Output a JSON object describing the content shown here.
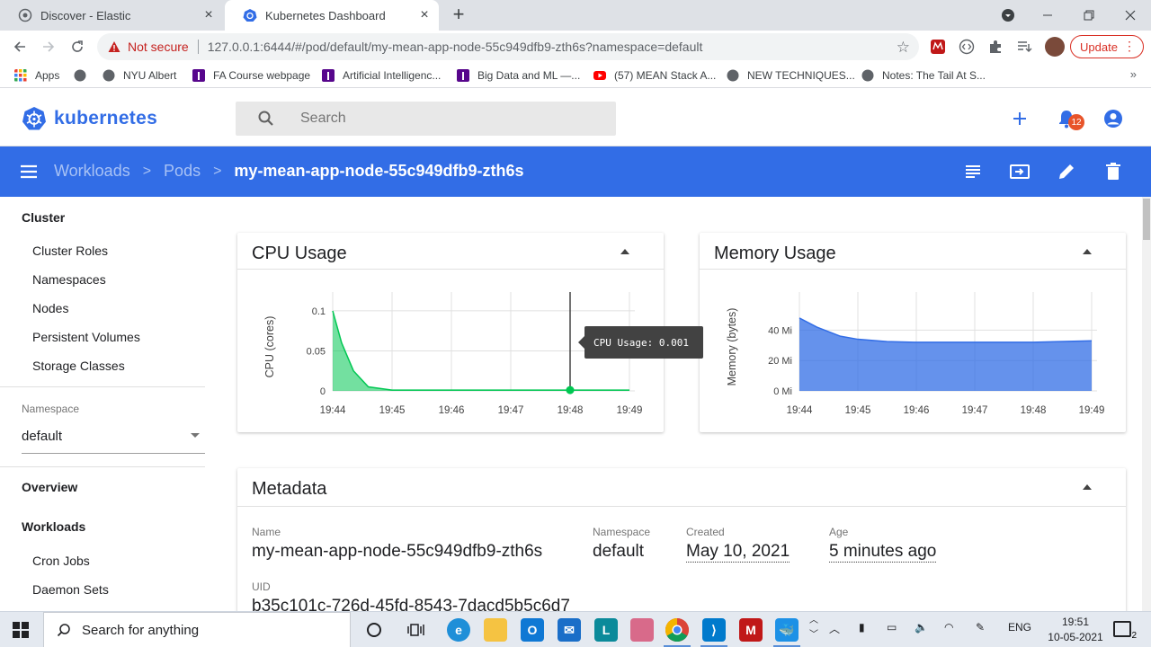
{
  "browser": {
    "tabs": [
      {
        "title": "Discover - Elastic",
        "active": false
      },
      {
        "title": "Kubernetes Dashboard",
        "active": true
      }
    ],
    "not_secure_label": "Not secure",
    "url": "127.0.0.1:6444/#/pod/default/my-mean-app-node-55c949dfb9-zth6s?namespace=default",
    "update_label": "Update",
    "bookmarks": [
      {
        "label": "Apps",
        "color": "#e8542a"
      },
      {
        "label": "",
        "color": "#5f6368"
      },
      {
        "label": "NYU Albert",
        "color": "#5f6368"
      },
      {
        "label": "FA Course webpage",
        "color": "#57068c"
      },
      {
        "label": "Artificial Intelligenc...",
        "color": "#57068c"
      },
      {
        "label": "Big Data and ML —...",
        "color": "#57068c"
      },
      {
        "label": "(57) MEAN Stack A...",
        "color": "#ff0000"
      },
      {
        "label": "NEW TECHNIQUES...",
        "color": "#5f6368"
      },
      {
        "label": "Notes: The Tail At S...",
        "color": "#5f6368"
      }
    ]
  },
  "header": {
    "brand": "kubernetes",
    "search_placeholder": "Search",
    "notification_count": "12",
    "accent": "#326de6"
  },
  "toolbar": {
    "breadcrumbs": [
      "Workloads",
      "Pods"
    ],
    "current": "my-mean-app-node-55c949dfb9-zth6s"
  },
  "sidebar": {
    "cluster_heading": "Cluster",
    "cluster_items": [
      "Cluster Roles",
      "Namespaces",
      "Nodes",
      "Persistent Volumes",
      "Storage Classes"
    ],
    "namespace_label": "Namespace",
    "namespace_value": "default",
    "overview": "Overview",
    "workloads_heading": "Workloads",
    "workload_items": [
      "Cron Jobs",
      "Daemon Sets"
    ]
  },
  "cpu_card": {
    "title": "CPU Usage",
    "tooltip": "CPU Usage: 0.001"
  },
  "memory_card": {
    "title": "Memory Usage"
  },
  "chart_data": [
    {
      "type": "area",
      "title": "CPU Usage",
      "ylabel": "CPU (cores)",
      "x": [
        "19:44",
        "19:45",
        "19:46",
        "19:47",
        "19:48",
        "19:49"
      ],
      "ylim": [
        0,
        0.11
      ],
      "yticks": [
        "0",
        "0.05",
        "0.1"
      ],
      "points": [
        [
          0,
          0.1
        ],
        [
          0.15,
          0.06
        ],
        [
          0.35,
          0.025
        ],
        [
          0.6,
          0.005
        ],
        [
          1,
          0.001
        ],
        [
          2,
          0.001
        ],
        [
          3,
          0.001
        ],
        [
          4,
          0.001
        ],
        [
          5,
          0.001
        ]
      ],
      "highlight": {
        "x": 4,
        "y": 0.001
      },
      "color": "#00c752"
    },
    {
      "type": "area",
      "title": "Memory Usage",
      "ylabel": "Memory (bytes)",
      "x": [
        "19:44",
        "19:45",
        "19:46",
        "19:47",
        "19:48",
        "19:49"
      ],
      "ylim": [
        0,
        58
      ],
      "yticks": [
        "0 Mi",
        "20 Mi",
        "40 Mi"
      ],
      "points": [
        [
          0,
          48
        ],
        [
          0.3,
          42
        ],
        [
          0.7,
          36
        ],
        [
          1,
          34
        ],
        [
          1.5,
          32.5
        ],
        [
          2,
          32
        ],
        [
          3,
          32
        ],
        [
          4,
          32
        ],
        [
          5,
          33
        ]
      ],
      "color": "#326de6"
    }
  ],
  "metadata": {
    "title": "Metadata",
    "name_label": "Name",
    "name_value": "my-mean-app-node-55c949dfb9-zth6s",
    "namespace_label": "Namespace",
    "namespace_value": "default",
    "created_label": "Created",
    "created_value": "May 10, 2021",
    "age_label": "Age",
    "age_value": "5 minutes ago",
    "uid_label": "UID",
    "uid_value": "b35c101c-726d-45fd-8543-7dacd5b5c6d7"
  },
  "taskbar": {
    "search_placeholder": "Search for anything",
    "lang": "ENG",
    "time": "19:51",
    "date": "10-05-2021",
    "notif_count": "2"
  }
}
